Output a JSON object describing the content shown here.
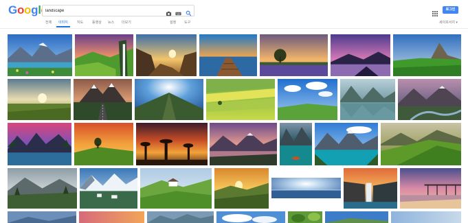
{
  "header": {
    "logo_letters": [
      {
        "char": "G",
        "color": "#4285f4"
      },
      {
        "char": "o",
        "color": "#ea4335"
      },
      {
        "char": "o",
        "color": "#fbbc05"
      },
      {
        "char": "g",
        "color": "#4285f4"
      },
      {
        "char": "l",
        "color": "#34a853"
      },
      {
        "char": "e",
        "color": "#ea4335"
      }
    ],
    "search_query": "landscape",
    "signin_label": "로그인",
    "tabs": [
      {
        "label": "전체"
      },
      {
        "label": "이미지"
      },
      {
        "label": "지도"
      },
      {
        "label": "동영상"
      },
      {
        "label": "뉴스"
      },
      {
        "label": "더보기"
      },
      {
        "label": "설정"
      },
      {
        "label": "도구"
      }
    ],
    "safesearch_label": "세이프서치 ▾",
    "accent_color": "#1a73e8",
    "icons": [
      "camera-icon",
      "keyboard-icon",
      "search-icon",
      "apps-icon"
    ]
  },
  "results": {
    "query": "landscape",
    "rows": [
      {
        "images": [
          {
            "subject": "mountain lake with flowers"
          },
          {
            "subject": "green hills and waterfall"
          },
          {
            "subject": "rocky canyon sunset"
          },
          {
            "subject": "wooden pier over lake at sunset"
          },
          {
            "subject": "lone tree with lavender field at sunset"
          },
          {
            "subject": "purple sky over mountain lake"
          },
          {
            "subject": "green meadow with mountain peak"
          }
        ]
      },
      {
        "images": [
          {
            "subject": "green field under sunrise sky"
          },
          {
            "subject": "road leading to mountains"
          },
          {
            "subject": "mountain ridge under blue sky"
          },
          {
            "subject": "green terraced fields"
          },
          {
            "subject": "meadow under blue sky with clouds"
          },
          {
            "subject": "misty mountain lake reflection"
          },
          {
            "subject": "rocky mountain stream"
          }
        ]
      },
      {
        "images": [
          {
            "subject": "mountain lake under pink sky"
          },
          {
            "subject": "lone tree on hill at sunset"
          },
          {
            "subject": "baobab trees at sunset"
          },
          {
            "subject": "mountains with pink sunset lake"
          },
          {
            "subject": "canoe on turquoise mountain lake"
          },
          {
            "subject": "turquoise glacial lake with peaks"
          },
          {
            "subject": "green valley slope at sunset"
          }
        ]
      },
      {
        "images": [
          {
            "subject": "foggy forest mountains"
          },
          {
            "subject": "snowy mountain village"
          },
          {
            "subject": "white house on green hills"
          },
          {
            "subject": "sunrise over valley"
          },
          {
            "subject": "sun over misty ocean"
          },
          {
            "subject": "waterfall at sunset"
          },
          {
            "subject": "pier with pink sunset clouds"
          }
        ]
      },
      {
        "images": [
          {
            "subject": "blue mountain horizon"
          },
          {
            "subject": "pink and orange sky"
          },
          {
            "subject": "blue misty mountains"
          },
          {
            "subject": "bright clouds over water"
          },
          {
            "subject": "leafy green foreground"
          },
          {
            "subject": "blue sky over hills"
          },
          {
            "subject": "evening sky over lake"
          }
        ]
      }
    ]
  }
}
